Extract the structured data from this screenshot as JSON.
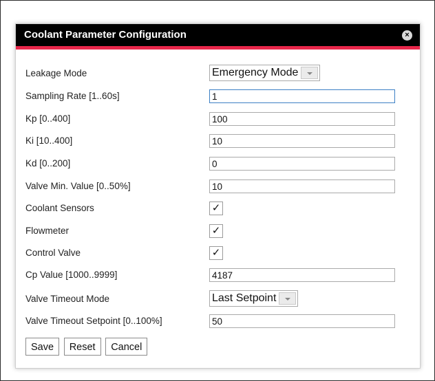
{
  "dialog": {
    "title": "Coolant Parameter Configuration",
    "close_glyph": "×"
  },
  "fields": {
    "leakage_mode": {
      "label": "Leakage Mode",
      "value": "Emergency Mode"
    },
    "sampling_rate": {
      "label": "Sampling Rate [1..60s]",
      "value": "1"
    },
    "kp": {
      "label": "Kp [0..400]",
      "value": "100"
    },
    "ki": {
      "label": "Ki [10..400]",
      "value": "10"
    },
    "kd": {
      "label": "Kd [0..200]",
      "value": "0"
    },
    "valve_min": {
      "label": "Valve Min. Value [0..50%]",
      "value": "10"
    },
    "coolant_sensors": {
      "label": "Coolant Sensors",
      "checked": true
    },
    "flowmeter": {
      "label": "Flowmeter",
      "checked": true
    },
    "control_valve": {
      "label": "Control Valve",
      "checked": true
    },
    "cp_value": {
      "label": "Cp Value [1000..9999]",
      "value": "4187"
    },
    "valve_timeout_mode": {
      "label": "Valve Timeout Mode",
      "value": "Last Setpoint"
    },
    "valve_timeout_setpoint": {
      "label": "Valve Timeout Setpoint [0..100%]",
      "value": "50"
    }
  },
  "checkmark_glyph": "✓",
  "buttons": {
    "save": "Save",
    "reset": "Reset",
    "cancel": "Cancel"
  },
  "colors": {
    "titlebar_bg": "#000000",
    "titlebar_accent": "#e8264a",
    "focus_border": "#3b7fc4"
  }
}
